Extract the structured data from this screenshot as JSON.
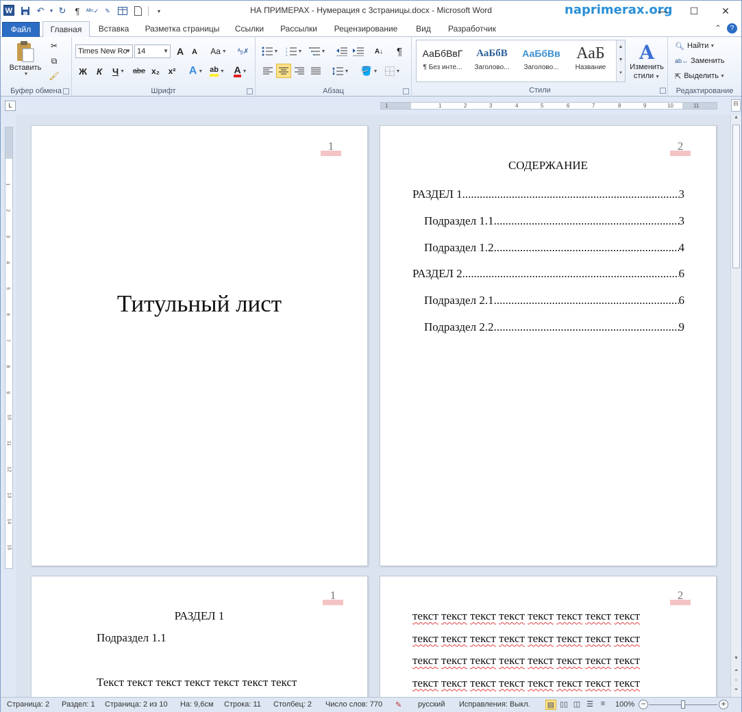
{
  "window": {
    "title": "НА ПРИМЕРАХ - Нумерация с 3страницы.docx - Microsoft Word",
    "watermark": "naprimerax.org",
    "app_icon": "W",
    "minimize": "—",
    "maximize": "☐",
    "close": "✕"
  },
  "tabs": [
    "Файл",
    "Главная",
    "Вставка",
    "Разметка страницы",
    "Ссылки",
    "Рассылки",
    "Рецензирование",
    "Вид",
    "Разработчик"
  ],
  "active_tab": "Главная",
  "ribbon": {
    "clipboard": {
      "label": "Буфер обмена",
      "paste": "Вставить"
    },
    "font": {
      "label": "Шрифт",
      "font_name": "Times New Ro",
      "font_size": "14",
      "bold": "Ж",
      "italic": "К",
      "underline": "Ч",
      "strike": "abe",
      "sub": "x₂",
      "sup": "x²",
      "grow": "A",
      "shrink": "A",
      "case": "Aa"
    },
    "paragraph": {
      "label": "Абзац",
      "pilcrow": "¶"
    },
    "styles": {
      "label": "Стили",
      "items": [
        {
          "preview": "АаБбВвГ",
          "name": "¶ Без инте..."
        },
        {
          "preview": "АаБбВ",
          "name": "Заголово..."
        },
        {
          "preview": "АаБбВв",
          "name": "Заголово..."
        },
        {
          "preview": "АаБ",
          "name": "Название"
        }
      ],
      "change_line1": "Изменить",
      "change_line2": "стили"
    },
    "editing": {
      "label": "Редактирование",
      "find": "Найти",
      "replace": "Заменить",
      "select": "Выделить"
    }
  },
  "pages": {
    "p1": {
      "number": "1",
      "title": "Титульный лист"
    },
    "p2": {
      "number": "2",
      "heading": "СОДЕРЖАНИЕ",
      "toc": [
        {
          "text": "РАЗДЕЛ 1",
          "page": "3",
          "level": 1
        },
        {
          "text": "Подраздел 1.1",
          "page": "3",
          "level": 2
        },
        {
          "text": "Подраздел 1.2",
          "page": "4",
          "level": 2
        },
        {
          "text": "РАЗДЕЛ 2",
          "page": "6",
          "level": 1
        },
        {
          "text": "Подраздел 2.1",
          "page": "6",
          "level": 2
        },
        {
          "text": "Подраздел 2.2",
          "page": "9",
          "level": 2
        }
      ]
    },
    "p3": {
      "number": "1",
      "heading": "РАЗДЕЛ 1",
      "subheading": "Подраздел 1.1",
      "body": "Текст текст текст текст текст текст текст"
    },
    "p4": {
      "number": "2",
      "word": "текст",
      "lines": 4,
      "words_per_line": 8
    }
  },
  "status": {
    "page": "Страница: 2",
    "section": "Раздел: 1",
    "page_of": "Страница: 2 из 10",
    "at": "На: 9,6см",
    "line": "Строка: 11",
    "column": "Столбец: 2",
    "words": "Число слов: 770",
    "language": "русский",
    "track": "Исправления: Выкл.",
    "zoom": "100%"
  }
}
